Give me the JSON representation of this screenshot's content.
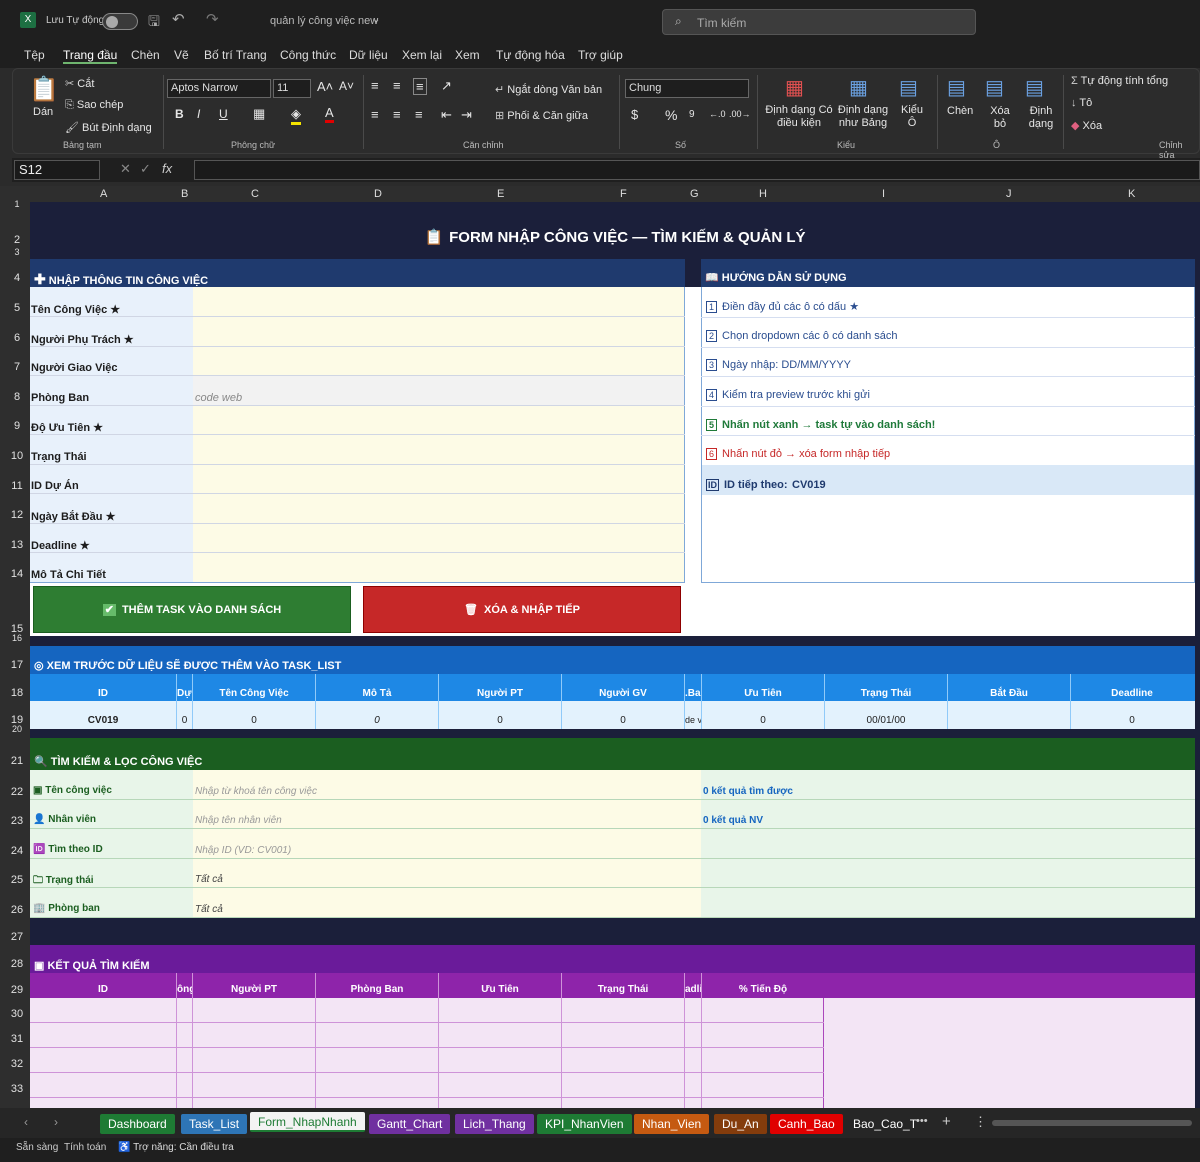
{
  "titlebar": {
    "autosave_label": "Lưu Tự động",
    "file_name": "quản lý công việc new",
    "search_placeholder": "Tìm kiếm"
  },
  "ribbon_tabs": [
    "Tệp",
    "Trang đầu",
    "Chèn",
    "Vẽ",
    "Bố trí Trang",
    "Công thức",
    "Dữ liệu",
    "Xem lại",
    "Xem",
    "Tự động hóa",
    "Trợ giúp"
  ],
  "ribbon": {
    "clipboard": {
      "paste": "Dán",
      "cut": "Cắt",
      "copy": "Sao chép",
      "format_painter": "Bút Định dạng",
      "group": "Bảng tạm"
    },
    "font": {
      "name": "Aptos Narrow",
      "size": "11",
      "bold": "B",
      "italic": "I",
      "underline": "U",
      "group": "Phông chữ"
    },
    "alignment": {
      "wrap": "Ngắt dòng Văn bản",
      "merge": "Phối & Căn giữa",
      "group": "Căn chỉnh"
    },
    "number": {
      "format": "Chung",
      "currency": "$",
      "percent": "%",
      "group": "Số"
    },
    "styles": {
      "conditional": "Định dạng Có điều kiện",
      "table": "Định dạng như Bảng",
      "cell_styles": "Kiểu Ô",
      "group": "Kiểu"
    },
    "cells": {
      "insert": "Chèn",
      "delete": "Xóa bỏ",
      "format": "Định dạng",
      "group": "Ô"
    },
    "editing": {
      "autosum": "Tự động tính tổng",
      "fill": "Tô",
      "clear": "Xóa",
      "group": "Chỉnh sửa"
    }
  },
  "formula_bar": {
    "name_box": "S12",
    "fx": "fx",
    "value": ""
  },
  "columns": [
    "A",
    "B",
    "C",
    "D",
    "E",
    "F",
    "G",
    "H",
    "I",
    "J",
    "K"
  ],
  "rows": [
    "1",
    "2",
    "3",
    "4",
    "5",
    "6",
    "7",
    "8",
    "9",
    "10",
    "11",
    "12",
    "13",
    "14",
    "15",
    "16",
    "17",
    "18",
    "19",
    "20",
    "21",
    "22",
    "23",
    "24",
    "25",
    "26",
    "27",
    "28",
    "29",
    "30",
    "31",
    "32",
    "33"
  ],
  "form": {
    "title": "FORM NHẬP CÔNG VIỆC — TÌM KIẾM & QUẢN LÝ",
    "section_input": "NHẬP THÔNG TIN CÔNG VIỆC",
    "fields": [
      {
        "label": "Tên Công Việc ★",
        "value": ""
      },
      {
        "label": "Người Phụ Trách ★",
        "value": ""
      },
      {
        "label": "Người Giao Việc",
        "value": ""
      },
      {
        "label": "Phòng Ban",
        "value": "code web"
      },
      {
        "label": "Độ Ưu Tiên ★",
        "value": ""
      },
      {
        "label": "Trạng Thái",
        "value": ""
      },
      {
        "label": "ID Dự Án",
        "value": ""
      },
      {
        "label": "Ngày Bắt Đầu ★",
        "value": ""
      },
      {
        "label": "Deadline ★",
        "value": ""
      },
      {
        "label": "Mô Tả Chi Tiết",
        "value": ""
      }
    ],
    "add_button": "THÊM TASK VÀO DANH SÁCH",
    "clear_button": "XÓA & NHẬP TIẾP"
  },
  "guide": {
    "title": "HƯỚNG DẪN SỬ DỤNG",
    "steps": [
      {
        "n": "1",
        "text": "Điền đầy đủ các ô có dấu ★"
      },
      {
        "n": "2",
        "text": "Chọn dropdown các ô có danh sách"
      },
      {
        "n": "3",
        "text": "Ngày nhập: DD/MM/YYYY"
      },
      {
        "n": "4",
        "text": "Kiểm tra preview trước khi gửi"
      },
      {
        "n": "5",
        "text": "Nhấn nút xanh → task tự vào danh sách!"
      },
      {
        "n": "6",
        "text": "Nhấn nút đỏ → xóa form nhập tiếp"
      }
    ],
    "next_id_label": "ID tiếp theo:",
    "next_id": "CV019",
    "id_badge": "ID"
  },
  "preview": {
    "title": "XEM TRƯỚC DỮ LIỆU SẼ ĐƯỢC THÊM VÀO TASK_LIST",
    "headers": [
      "ID",
      "Dự",
      "Tên Công Việc",
      "Mô Tả",
      "Người PT",
      "Người GV",
      ".Ba",
      "Ưu Tiên",
      "Trạng Thái",
      "Bắt Đầu",
      "Deadline"
    ],
    "row": [
      "CV019",
      "0",
      "0",
      "0",
      "0",
      "0",
      "de v",
      "0",
      "00/01/00",
      "",
      "0"
    ]
  },
  "search": {
    "title": "TÌM KIẾM & LỌC CÔNG VIỆC",
    "fields": [
      {
        "label": "Tên công việc",
        "value": "Nhập từ khoá tên công việc",
        "result": "0 kết quả tìm được"
      },
      {
        "label": "Nhân viên",
        "value": "Nhập tên nhân viên",
        "result": "0 kết quả NV"
      },
      {
        "label": "Tìm theo ID",
        "value": "Nhập ID (VD: CV001)",
        "result": ""
      },
      {
        "label": "Trạng thái",
        "value": "Tất cả",
        "result": ""
      },
      {
        "label": "Phòng ban",
        "value": "Tất cả",
        "result": ""
      }
    ]
  },
  "results": {
    "title": "KẾT QUẢ TÌM KIẾM",
    "headers": [
      "ID",
      "ông",
      "Người PT",
      "Phòng Ban",
      "Ưu Tiên",
      "Trạng Thái",
      "adli",
      "% Tiến Độ"
    ]
  },
  "sheet_tabs": [
    {
      "name": "Dashboard",
      "color": "#1e7b34"
    },
    {
      "name": "Task_List",
      "color": "#2e75b6"
    },
    {
      "name": "Form_NhapNhanh",
      "color": "#f3f3f3"
    },
    {
      "name": "Gantt_Chart",
      "color": "#7030a0"
    },
    {
      "name": "Lich_Thang",
      "color": "#7030a0"
    },
    {
      "name": "KPI_NhanVien",
      "color": "#1e7b34"
    },
    {
      "name": "Nhan_Vien",
      "color": "#c55a11"
    },
    {
      "name": "Du_An",
      "color": "#843c0c"
    },
    {
      "name": "Canh_Bao",
      "color": "#e00000"
    },
    {
      "name": "Bao_Cao_T",
      "color": "#262626"
    }
  ],
  "status": {
    "ready": "Sẵn sàng",
    "calc": "Tính toán",
    "accessibility": "Trợ năng: Cần điều tra"
  }
}
